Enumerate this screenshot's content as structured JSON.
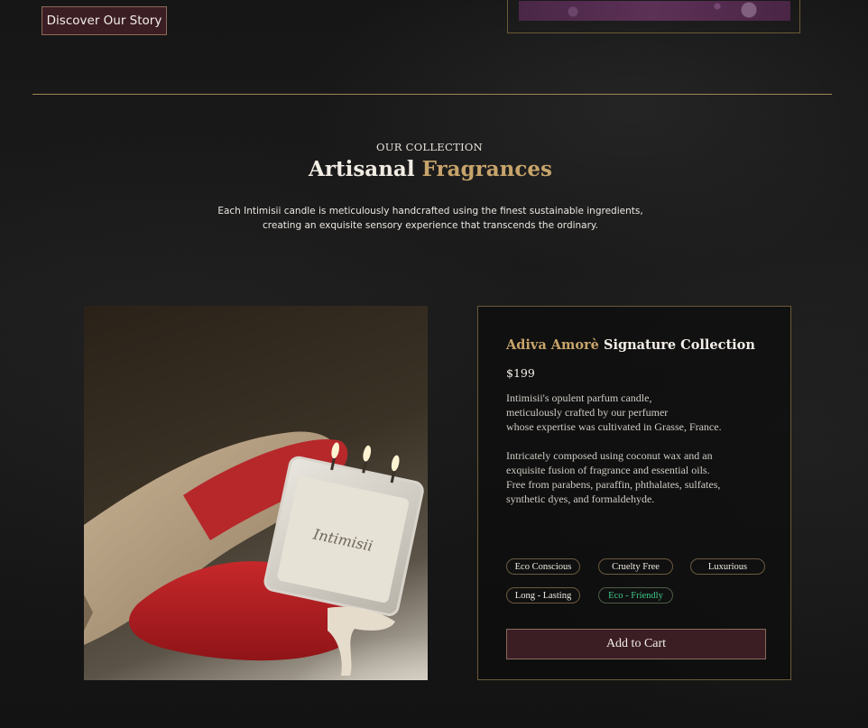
{
  "hero": {
    "cta_label": "Discover Our Story"
  },
  "collection": {
    "eyebrow": "OUR COLLECTION",
    "title_part1": "Artisanal",
    "title_part2": "Fragrances",
    "description_line1": "Each Intimisii candle is meticulously handcrafted using the finest sustainable ingredients,",
    "description_line2": "creating an exquisite sensory experience that transcends the ordinary."
  },
  "product": {
    "name_highlight": "Adiva Amorè",
    "name_rest": "Signature Collection",
    "price": "$199",
    "description_p1": [
      "Intimisii's opulent parfum candle,",
      "meticulously crafted by our perfumer",
      "whose expertise was cultivated in Grasse, France."
    ],
    "description_p2": [
      "Intricately composed using coconut wax and an",
      "exquisite fusion of fragrance and essential oils.",
      "Free from parabens, paraffin, phthalates, sulfates,",
      "synthetic dyes, and formaldehyde."
    ],
    "tags": [
      "Eco Conscious",
      "Cruelty Free",
      "Luxurious",
      "Long - Lasting",
      "Eco - Friendly"
    ],
    "add_to_cart_label": "Add to Cart",
    "candle_brand": "Intimisii"
  },
  "colors": {
    "gold": "#c7a46b",
    "burgundy": "#3b1e24",
    "eco_green": "#3ec98a",
    "background": "#141414"
  }
}
